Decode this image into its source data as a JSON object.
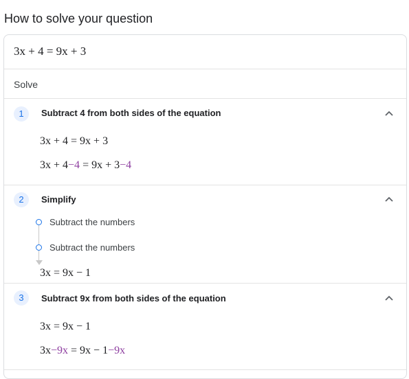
{
  "heading": "How to solve your question",
  "equation": "3x + 4 = 9x + 3",
  "solve_label": "Solve",
  "steps": [
    {
      "number": "1",
      "title": "Subtract 4 from both sides of the equation",
      "line1": "3x + 4 = 9x + 3",
      "line2_parts": [
        "3x + 4",
        "−4",
        " = 9x + 3",
        "−4"
      ]
    },
    {
      "number": "2",
      "title": "Simplify",
      "subitems": [
        "Subtract the numbers",
        "Subtract the numbers"
      ],
      "result": "3x = 9x − 1"
    },
    {
      "number": "3",
      "title": "Subtract 9x from both sides of the equation",
      "line1": "3x = 9x − 1",
      "line2_parts": [
        "3x",
        "−9x",
        " = 9x − 1",
        "−9x"
      ]
    }
  ],
  "colors": {
    "accent": "#1a73e8",
    "highlight": "#8e3fa0",
    "step_badge_bg": "#e8f0fe"
  },
  "icons": {
    "collapse": "chevron-up-icon"
  }
}
